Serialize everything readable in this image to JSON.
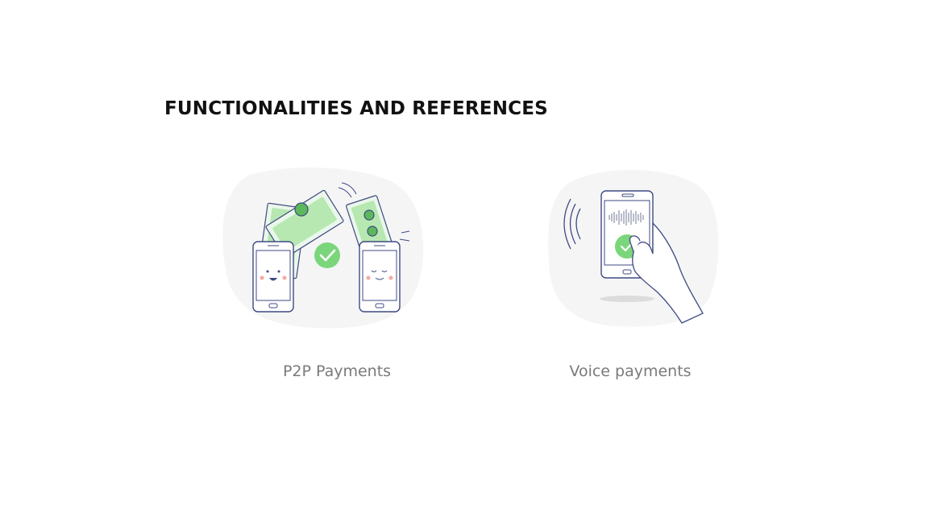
{
  "page": {
    "title": "FUNCTIONALITIES AND REFERENCES"
  },
  "features": [
    {
      "label": "P2P Payments",
      "illustration_icon": "p2p-payment-icon"
    },
    {
      "label": "Voice payments",
      "illustration_icon": "voice-payment-icon"
    }
  ],
  "colors": {
    "title": "#111111",
    "label": "#7a7a7a",
    "accent_green": "#7bd67b",
    "blob_background": "#f5f5f6",
    "line_navy": "#3f4a82"
  }
}
